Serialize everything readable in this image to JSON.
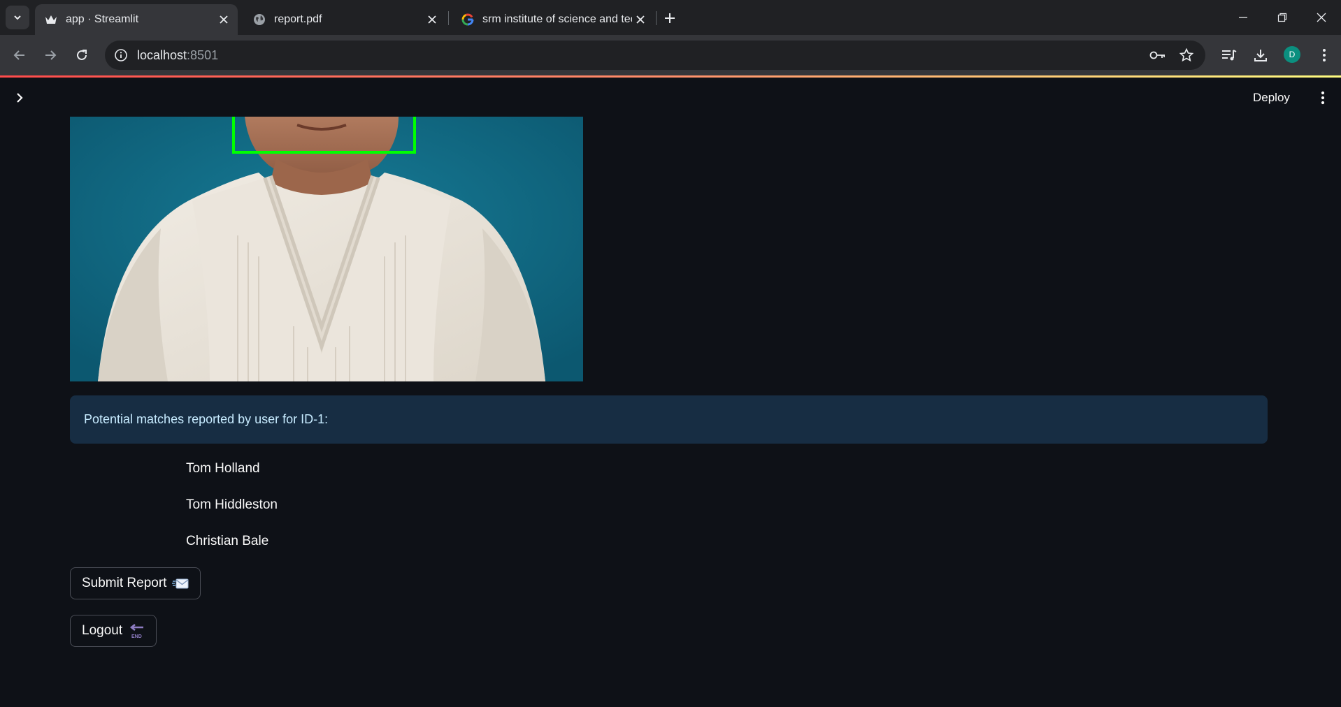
{
  "browser": {
    "tabs": [
      {
        "title": "app · Streamlit",
        "active": true,
        "favicon": "streamlit-crown-icon"
      },
      {
        "title": "report.pdf",
        "active": false,
        "favicon": "globe-icon"
      },
      {
        "title": "srm institute of science and tec",
        "active": false,
        "favicon": "google-icon"
      }
    ],
    "url_host": "localhost",
    "url_port": ":8501",
    "profile_initial": "D"
  },
  "header": {
    "deploy_label": "Deploy"
  },
  "main": {
    "info_text": "Potential matches reported by user for ID-1:",
    "matches": [
      "Tom Holland",
      "Tom Hiddleston",
      "Christian Bale"
    ],
    "submit_label": "Submit Report",
    "submit_emoji": "incoming-envelope-icon",
    "logout_label": "Logout",
    "logout_emoji": "end-arrow-icon"
  },
  "colors": {
    "app_bg": "#0e1117",
    "info_bg": "#172d43",
    "info_text": "#c7ebff",
    "face_box": "#00ff00"
  }
}
